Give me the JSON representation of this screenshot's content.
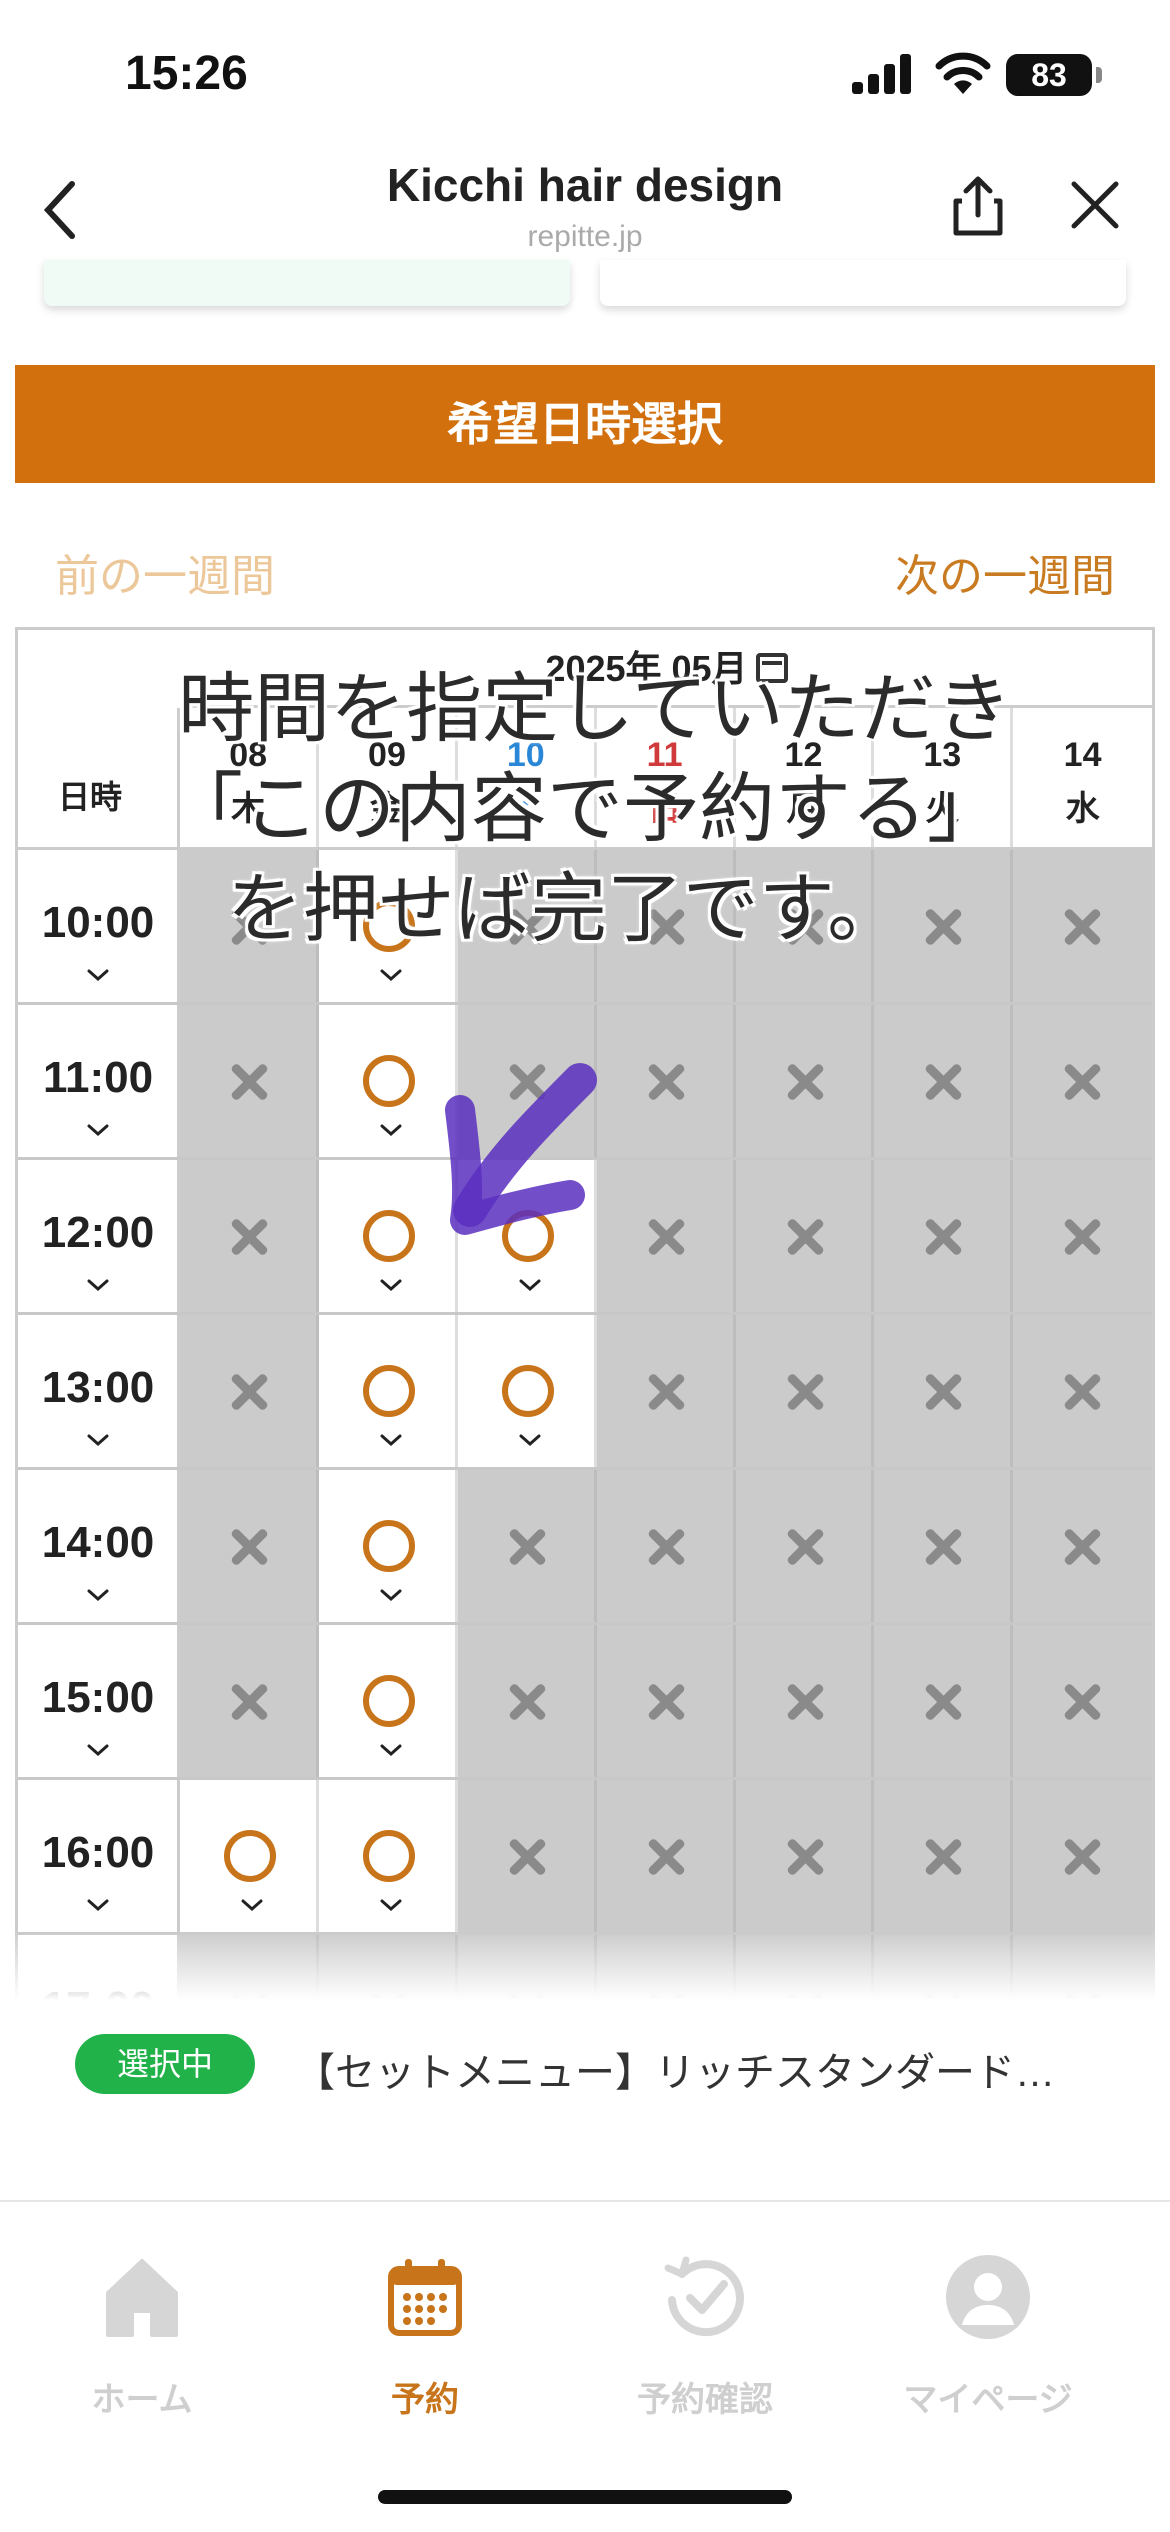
{
  "status": {
    "time": "15:26",
    "battery": "83"
  },
  "nav": {
    "title": "Kicchi hair design",
    "subtitle": "repitte.jp"
  },
  "banner": "希望日時選択",
  "week": {
    "prev": "前の一週間",
    "next": "次の一週間"
  },
  "calendar": {
    "month": "2025年 05月",
    "corner": "日時",
    "days": [
      {
        "date": "08",
        "dow": "木"
      },
      {
        "date": "09",
        "dow": "金"
      },
      {
        "date": "10",
        "dow": "土"
      },
      {
        "date": "11",
        "dow": "日"
      },
      {
        "date": "12",
        "dow": "月"
      },
      {
        "date": "13",
        "dow": "火"
      },
      {
        "date": "14",
        "dow": "水"
      }
    ],
    "rows": [
      {
        "time": "10:00",
        "slots": [
          "x",
          "o",
          "x",
          "x",
          "x",
          "x",
          "x"
        ]
      },
      {
        "time": "11:00",
        "slots": [
          "x",
          "o",
          "x",
          "x",
          "x",
          "x",
          "x"
        ]
      },
      {
        "time": "12:00",
        "slots": [
          "x",
          "o",
          "o",
          "x",
          "x",
          "x",
          "x"
        ]
      },
      {
        "time": "13:00",
        "slots": [
          "x",
          "o",
          "o",
          "x",
          "x",
          "x",
          "x"
        ]
      },
      {
        "time": "14:00",
        "slots": [
          "x",
          "o",
          "x",
          "x",
          "x",
          "x",
          "x"
        ]
      },
      {
        "time": "15:00",
        "slots": [
          "x",
          "o",
          "x",
          "x",
          "x",
          "x",
          "x"
        ]
      },
      {
        "time": "16:00",
        "slots": [
          "o",
          "o",
          "x",
          "x",
          "x",
          "x",
          "x"
        ]
      },
      {
        "time": "17:00",
        "slots": [
          "x",
          "x",
          "x",
          "x",
          "x",
          "x",
          "x"
        ]
      }
    ]
  },
  "overlay": {
    "line1": "時間を指定していただき",
    "line2": "「この内容で予約する」",
    "line3": "を押せば完了です。"
  },
  "selection": {
    "badge": "選択中",
    "text": "【セットメニュー】リッチスタンダード…"
  },
  "tabs": [
    {
      "label": "ホーム",
      "icon": "home-icon"
    },
    {
      "label": "予約",
      "icon": "calendar-icon"
    },
    {
      "label": "予約確認",
      "icon": "history-check-icon"
    },
    {
      "label": "マイページ",
      "icon": "user-icon"
    }
  ],
  "colors": {
    "accent": "#d2700e",
    "available": "#c8741a",
    "unavailable_bg": "#cbcbcb",
    "badge": "#21b34a",
    "saturday": "#2a86d6",
    "sunday": "#d13a3a"
  }
}
